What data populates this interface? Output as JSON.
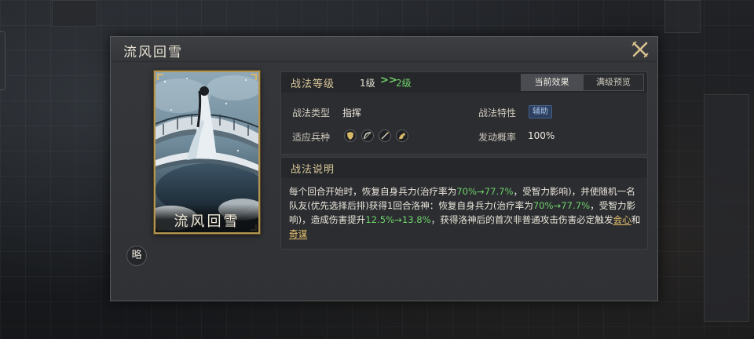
{
  "dialog": {
    "title": "流风回雪",
    "close_icon": "close-x-icon"
  },
  "card": {
    "name": "流风回雪"
  },
  "abbrev_badge": "略",
  "info": {
    "level_label": "战法等级",
    "level_from": "1级",
    "level_arrow": ">>",
    "level_to": "2级",
    "tabs": [
      {
        "label": "当前效果",
        "active": true
      },
      {
        "label": "满级预览",
        "active": false
      }
    ],
    "type_label": "战法类型",
    "type_value": "指挥",
    "trait_label": "战法特性",
    "trait_value": "辅助",
    "unit_label": "适应兵种",
    "unit_icons": [
      "shield-icon",
      "bow-icon",
      "spear-icon",
      "horse-icon"
    ],
    "chance_label": "发动概率",
    "chance_value": "100%"
  },
  "description": {
    "label": "战法说明",
    "seg1": "每个回合开始时，恢复自身兵力(治疗率为",
    "seg2": "70%→77.7%",
    "seg3": "，受智力影响)，并使随机一名队友(优先选择后排)获得1回合洛神：恢复自身兵力(治疗率为",
    "seg4": "70%→77.7%",
    "seg5": "，受智力影响)，造成伤害提升",
    "seg6": "12.5%→13.8%",
    "seg7": "，获得洛神后的首次非普通攻击伤害必定触发",
    "link1": "会心",
    "seg8": "和",
    "link2": "奇谋"
  },
  "colors": {
    "gold": "#d9c79a",
    "green": "#6fd06a",
    "link": "#e7c26b",
    "card_border": "#b39450"
  }
}
